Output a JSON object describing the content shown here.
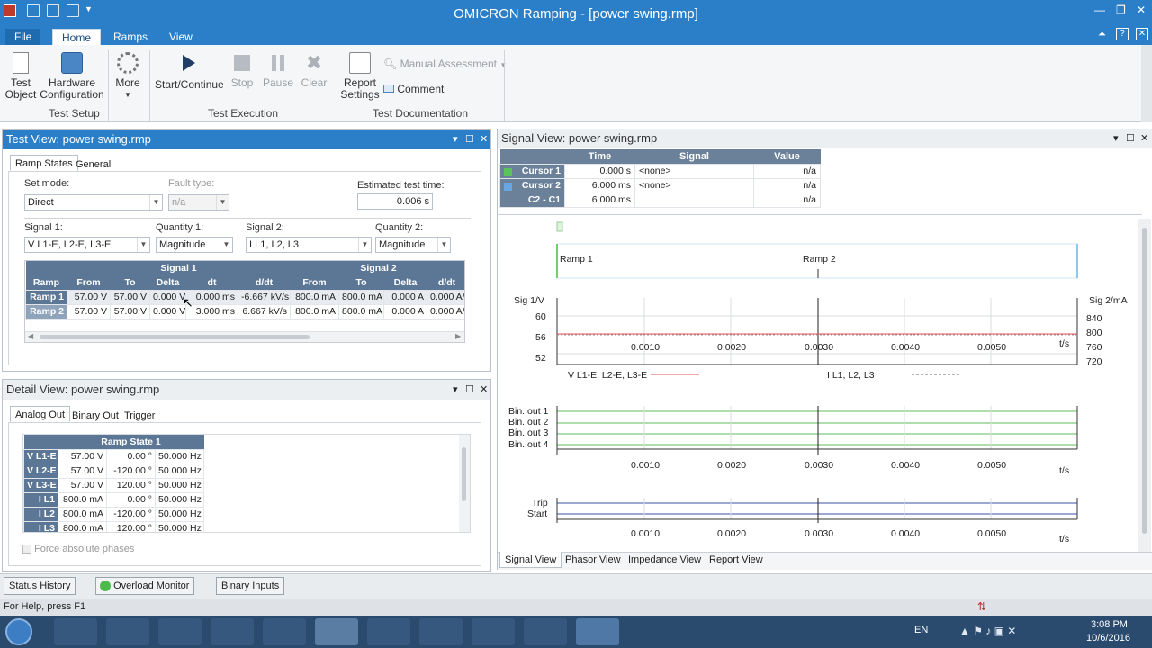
{
  "window": {
    "title": "OMICRON Ramping - [power swing.rmp]"
  },
  "ribbon": {
    "tabs": [
      "File",
      "Home",
      "Ramps",
      "View"
    ],
    "test_setup": {
      "label": "Test Setup",
      "test_object": "Test\nObject",
      "hardware_config": "Hardware\nConfiguration"
    },
    "more": "More",
    "test_execution": {
      "label": "Test Execution",
      "start": "Start/Continue",
      "stop": "Stop",
      "pause": "Pause",
      "clear": "Clear"
    },
    "test_documentation": {
      "label": "Test Documentation",
      "report_settings": "Report\nSettings",
      "manual_assessment": "Manual Assessment",
      "comment": "Comment"
    }
  },
  "test_view": {
    "title": "Test View: power swing.rmp",
    "tabs": [
      "Ramp States",
      "General"
    ],
    "set_mode_label": "Set mode:",
    "set_mode": "Direct",
    "fault_type_label": "Fault type:",
    "fault_type": "n/a",
    "est_time_label": "Estimated test time:",
    "est_time": "0.006 s",
    "signal1_label": "Signal 1:",
    "signal1": "V L1-E, L2-E, L3-E",
    "quantity1_label": "Quantity 1:",
    "quantity1": "Magnitude",
    "signal2_label": "Signal 2:",
    "signal2": "I L1, L2, L3",
    "quantity2_label": "Quantity 2:",
    "quantity2": "Magnitude",
    "table": {
      "group1": "Signal 1",
      "group2": "Signal 2",
      "headers": [
        "Ramp",
        "From",
        "To",
        "Delta",
        "dt",
        "d/dt",
        "From",
        "To",
        "Delta",
        "d/dt"
      ],
      "rows": [
        [
          "Ramp 1",
          "57.00 V",
          "57.00 V",
          "0.000 V",
          "0.000 ms",
          "-6.667 kV/s",
          "800.0 mA",
          "800.0 mA",
          "0.000 A",
          "0.000 A/"
        ],
        [
          "Ramp 2",
          "57.00 V",
          "57.00 V",
          "0.000 V",
          "3.000 ms",
          "6.667 kV/s",
          "800.0 mA",
          "800.0 mA",
          "0.000 A",
          "0.000 A/"
        ]
      ]
    }
  },
  "detail_view": {
    "title": "Detail View: power swing.rmp",
    "tabs": [
      "Analog Out",
      "Binary Out",
      "Trigger"
    ],
    "header": "Ramp State 1",
    "rows": [
      [
        "V L1-E",
        "57.00 V",
        "0.00 °",
        "50.000 Hz"
      ],
      [
        "V L2-E",
        "57.00 V",
        "-120.00 °",
        "50.000 Hz"
      ],
      [
        "V L3-E",
        "57.00 V",
        "120.00 °",
        "50.000 Hz"
      ],
      [
        "I L1",
        "800.0 mA",
        "0.00 °",
        "50.000 Hz"
      ],
      [
        "I L2",
        "800.0 mA",
        "-120.00 °",
        "50.000 Hz"
      ],
      [
        "I L3",
        "800.0 mA",
        "120.00 °",
        "50.000 Hz"
      ]
    ],
    "force_abs": "Force absolute phases"
  },
  "signal_view": {
    "title": "Signal View: power swing.rmp",
    "cursor_headers": [
      "Time",
      "Signal",
      "Value"
    ],
    "cursors": [
      {
        "name": "Cursor 1",
        "time": "0.000 s",
        "signal": "<none>",
        "value": "n/a",
        "color": "#5cc35c"
      },
      {
        "name": "Cursor 2",
        "time": "6.000 ms",
        "signal": "<none>",
        "value": "n/a",
        "color": "#6aa7e0"
      },
      {
        "name": "C2 - C1",
        "time": "6.000 ms",
        "signal": "",
        "value": "n/a",
        "color": ""
      }
    ],
    "ramp_labels": [
      "Ramp 1",
      "Ramp 2"
    ],
    "sig1_label": "Sig 1/V",
    "sig2_label": "Sig 2/mA",
    "y1_ticks": [
      "60",
      "56",
      "52"
    ],
    "y2_ticks": [
      "840",
      "800",
      "760",
      "720"
    ],
    "x_ticks": [
      "0.0010",
      "0.0020",
      "0.0030",
      "0.0040",
      "0.0050"
    ],
    "x_unit": "t/s",
    "legend": [
      "V L1-E, L2-E, L3-E",
      "I L1, L2, L3"
    ],
    "binary_labels": [
      "Bin. out 1",
      "Bin. out 2",
      "Bin. out 3",
      "Bin. out 4"
    ],
    "trip_labels": [
      "Trip",
      "Start"
    ],
    "bottom_tabs": [
      "Signal View",
      "Phasor View",
      "Impedance View",
      "Report View"
    ]
  },
  "status": {
    "buttons": [
      "Status History",
      "Overload Monitor",
      "Binary Inputs"
    ],
    "help": "For Help, press F1"
  },
  "taskbar": {
    "lang": "EN",
    "time": "3:08 PM",
    "date": "10/6/2016"
  }
}
